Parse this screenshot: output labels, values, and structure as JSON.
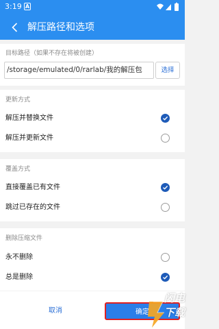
{
  "status_bar": {
    "time": "3:19",
    "notif_letter": "A"
  },
  "app_bar": {
    "title": "解压路径和选项"
  },
  "target": {
    "header": "目标路径（如果不存在将被创建）",
    "path_value": "/storage/emulated/0/rarlab/我的解压包",
    "select_label": "选择"
  },
  "update_mode": {
    "header": "更新方式",
    "options": [
      {
        "label": "解压并替换文件",
        "checked": true
      },
      {
        "label": "解压并更新文件",
        "checked": false
      }
    ]
  },
  "overwrite_mode": {
    "header": "覆盖方式",
    "options": [
      {
        "label": "直接覆盖已有文件",
        "checked": true
      },
      {
        "label": "跳过已存在的文件",
        "checked": false
      }
    ]
  },
  "delete_archive": {
    "header": "删除压缩文件",
    "options": [
      {
        "label": "永不删除",
        "checked": false
      },
      {
        "label": "总是删除",
        "checked": true
      }
    ]
  },
  "buttons": {
    "cancel": "取消",
    "confirm": "确定"
  },
  "watermark": {
    "text": "闪电下载"
  },
  "colors": {
    "primary": "#2b8ef0",
    "checked": "#1e5bb8",
    "highlight_border": "#e02020"
  }
}
